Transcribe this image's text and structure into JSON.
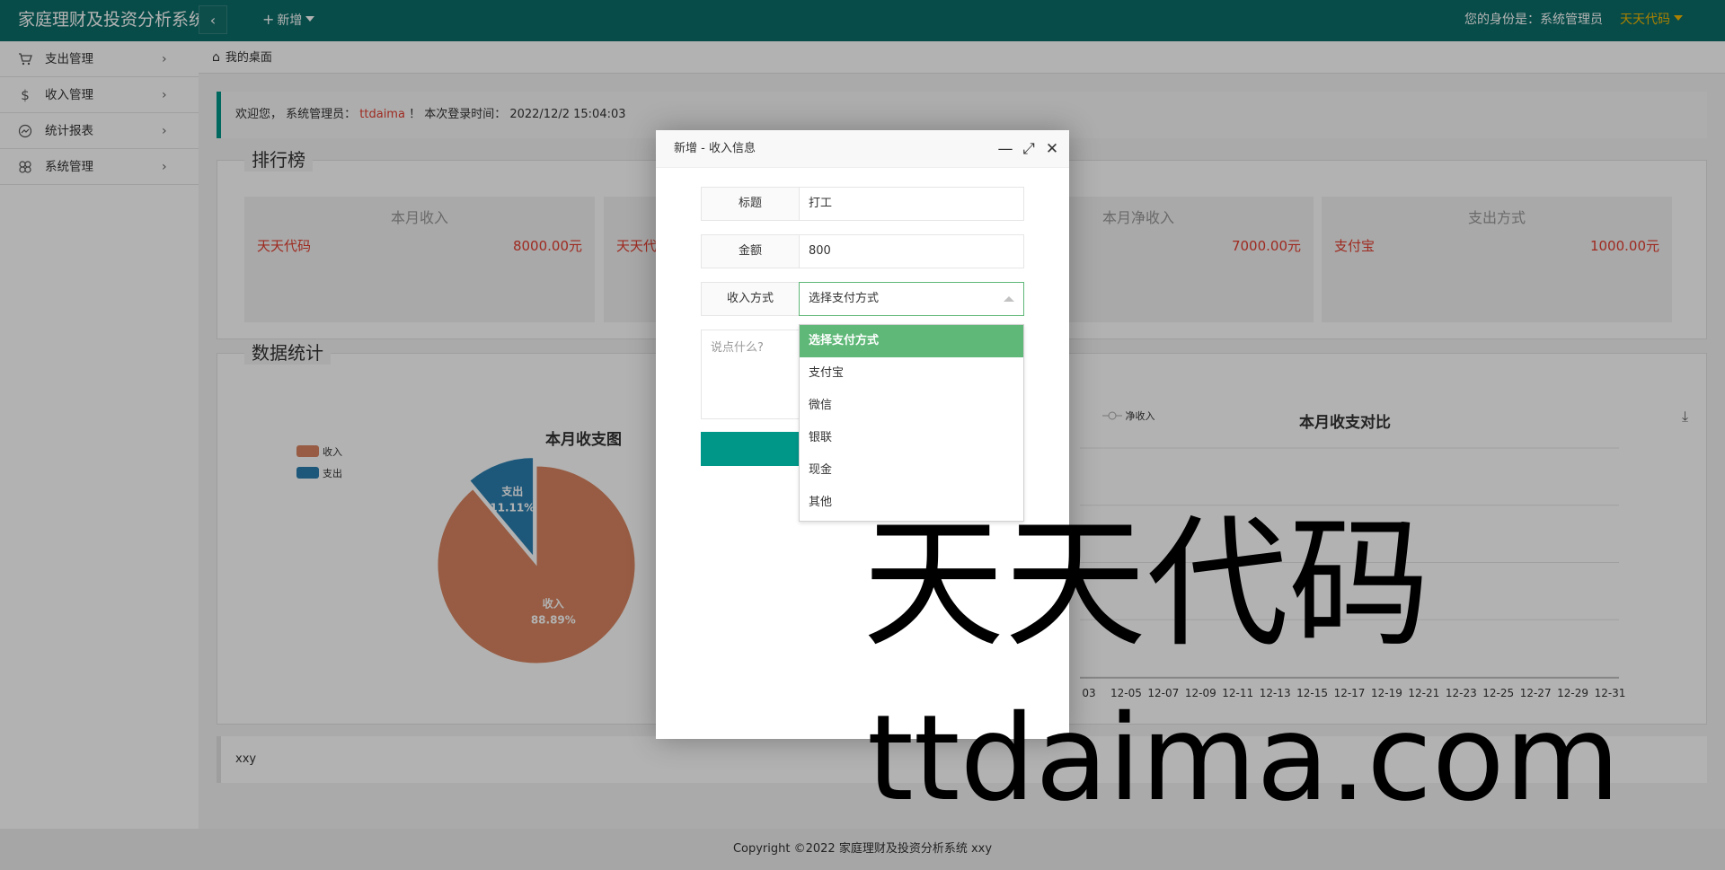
{
  "header": {
    "app_title": "家庭理财及投资分析系统",
    "new_label": "新增",
    "identity_label": "您的身份是：系统管理员",
    "user_name": "天天代码"
  },
  "sidebar": {
    "items": [
      {
        "label": "支出管理",
        "icon": "cart-icon"
      },
      {
        "label": "收入管理",
        "icon": "dollar-icon"
      },
      {
        "label": "统计报表",
        "icon": "chart-icon"
      },
      {
        "label": "系统管理",
        "icon": "clover-icon"
      }
    ]
  },
  "breadcrumb": {
    "label": "我的桌面"
  },
  "welcome": {
    "prefix": "欢迎您，  系统管理员：",
    "username": "ttdaima",
    "suffix": "！ 本次登录时间： 2022/12/2 15:04:03"
  },
  "ranking": {
    "title": "排行榜",
    "cards": [
      {
        "title": "本月收入",
        "name": "天天代码",
        "value": "8000.00元"
      },
      {
        "title": "",
        "name": "天天代",
        "value": ""
      },
      {
        "title": "本月净收入",
        "name": "",
        "value": "7000.00元"
      },
      {
        "title": "支出方式",
        "name": "支付宝",
        "value": "1000.00元"
      }
    ]
  },
  "stats": {
    "title": "数据统计",
    "pie_title": "本月收支图",
    "line_title": "本月收支对比",
    "line_legend": "净收入",
    "pie_legend": [
      "收入",
      "支出"
    ]
  },
  "chart_data": [
    {
      "type": "pie",
      "title": "本月收支图",
      "labels": [
        "收入",
        "支出"
      ],
      "values": [
        88.89,
        11.11
      ],
      "display": [
        "88.89%",
        "11.11%"
      ],
      "colors": [
        "#d98560",
        "#2a7fb1"
      ],
      "legend": "top-left"
    },
    {
      "type": "line",
      "title": "本月收支对比",
      "x_tick_labels": [
        "03",
        "12-05",
        "12-07",
        "12-09",
        "12-11",
        "12-13",
        "12-15",
        "12-17",
        "12-19",
        "12-21",
        "12-23",
        "12-25",
        "12-27",
        "12-29",
        "12-31"
      ],
      "series_name": "净收入"
    }
  ],
  "footer": {
    "text": "xxy"
  },
  "copyright": {
    "text": "Copyright ©2022 家庭理财及投资分析系统 xxy"
  },
  "modal": {
    "title": "新增 - 收入信息",
    "fields": {
      "title_label": "标题",
      "title_value": "打工",
      "amount_label": "金额",
      "amount_value": "800",
      "method_label": "收入方式",
      "method_value": "选择支付方式",
      "remark_placeholder": "说点什么?"
    },
    "dropdown_options": [
      "选择支付方式",
      "支付宝",
      "微信",
      "银联",
      "现金",
      "其他"
    ]
  },
  "watermark": {
    "line1": "天天代码",
    "line2": "ttdaima.com"
  }
}
